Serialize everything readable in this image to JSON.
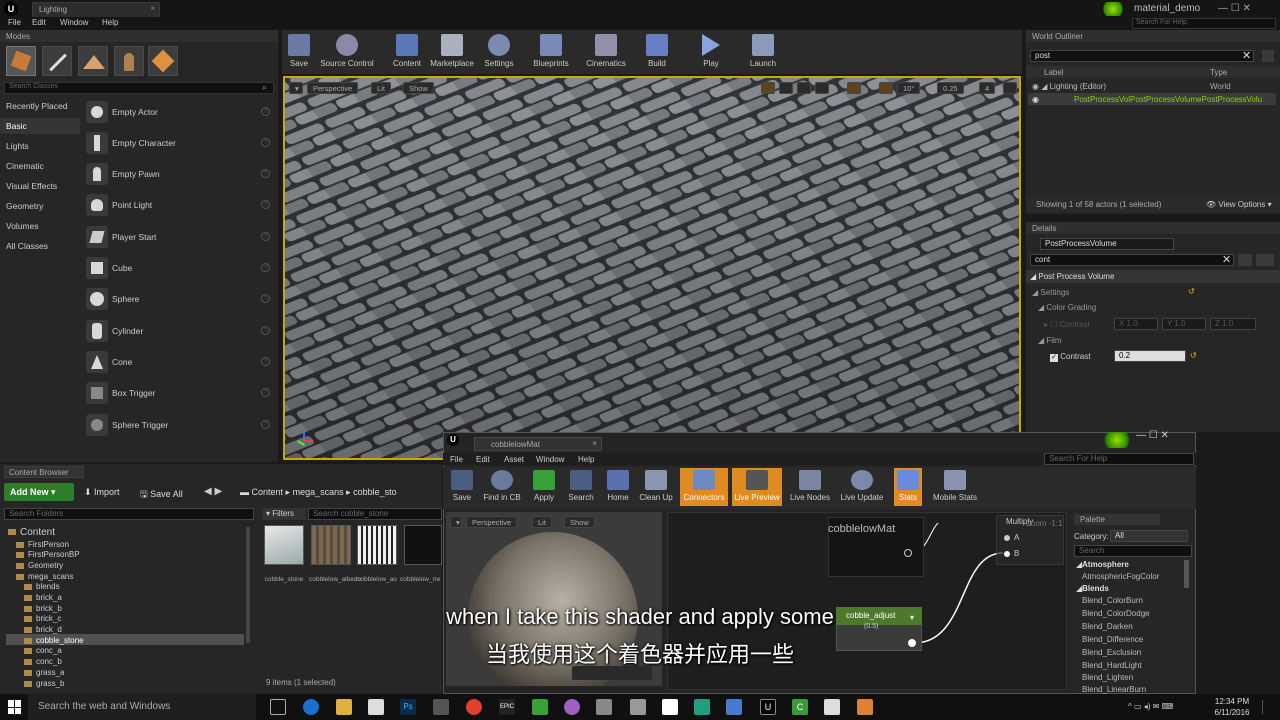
{
  "window": {
    "tab_title": "Lighting",
    "project_name": "material_demo",
    "help_search_placeholder": "Search For Help",
    "menu": [
      "File",
      "Edit",
      "Window",
      "Help"
    ]
  },
  "modes": {
    "header": "Modes",
    "search_placeholder": "Search Classes",
    "categories": [
      "Recently Placed",
      "Basic",
      "Lights",
      "Cinematic",
      "Visual Effects",
      "Geometry",
      "Volumes",
      "All Classes"
    ],
    "selected_category": "Basic",
    "items": [
      "Empty Actor",
      "Empty Character",
      "Empty Pawn",
      "Point Light",
      "Player Start",
      "Cube",
      "Sphere",
      "Cylinder",
      "Cone",
      "Box Trigger",
      "Sphere Trigger"
    ]
  },
  "toolbar": {
    "buttons": [
      "Save",
      "Source Control",
      "Content",
      "Marketplace",
      "Settings",
      "Blueprints",
      "Cinematics",
      "Build",
      "Play",
      "Launch"
    ]
  },
  "viewport": {
    "perspective": "Perspective",
    "lit": "Lit",
    "show": "Show",
    "snap_angle": "10°",
    "snap_scale": "0.25",
    "cam_speed": "4"
  },
  "outliner": {
    "header": "World Outliner",
    "search_value": "post",
    "col_label": "Label",
    "col_type": "Type",
    "row1_label": "Lighting (Editor)",
    "row1_type": "World",
    "row2_label": "PostProcessVolPostProcessVolumePostProcessVolu",
    "status": "Showing 1 of 58 actors (1 selected)",
    "view_options": "View Options"
  },
  "details": {
    "header": "Details",
    "name_value": "PostProcessVolume",
    "search_value": "cont",
    "section": "Post Process Volume",
    "settings": "Settings",
    "color_grading": "Color Grading",
    "contrast_label": "Contrast",
    "x": "X 1.0",
    "y": "Y 1.0",
    "z": "Z 1.0",
    "film": "Film",
    "film_contrast_label": "Contrast",
    "film_contrast_value": "0.2"
  },
  "content_browser": {
    "header": "Content Browser",
    "add_new": "Add New",
    "import": "Import",
    "save_all": "Save All",
    "path": [
      "Content",
      "mega_scans",
      "cobble_sto"
    ],
    "search_folders": "Search Folders",
    "filters": "Filters",
    "search_assets": "Search cobble_stone",
    "tree": [
      "Content",
      "FirstPerson",
      "FirstPersonBP",
      "Geometry",
      "mega_scans",
      "blends",
      "brick_a",
      "brick_b",
      "brick_c",
      "brick_d",
      "cobble_stone",
      "conc_a",
      "conc_b",
      "grass_a",
      "grass_b"
    ],
    "selected_folder": "cobble_stone",
    "assets": [
      "cobble_stone",
      "cobblelow_albedo",
      "cobblelow_ao",
      "cobblelow_metallic"
    ],
    "status": "9 items (1 selected)"
  },
  "material_editor": {
    "tab_title": "cobblelowMat",
    "menu": [
      "File",
      "Edit",
      "Asset",
      "Window",
      "Help"
    ],
    "help_search": "Search For Help",
    "buttons": [
      "Save",
      "Find in CB",
      "Apply",
      "Search",
      "Home",
      "Clean Up",
      "Connectors",
      "Live Preview",
      "Live Nodes",
      "Live Update",
      "Stats",
      "Mobile Stats"
    ],
    "highlighted": [
      "Connectors",
      "Live Preview",
      "Stats"
    ],
    "preview_perspective": "Perspective",
    "preview_lit": "Lit",
    "preview_show": "Show",
    "node_main": "cobblelowMat",
    "node_multiply": "Multiply",
    "pin_a": "A",
    "pin_b": "B",
    "node_param": "cobble_adjust",
    "node_param_value": "(0.5)",
    "zoom": "Zoom -1:1"
  },
  "palette": {
    "header": "Palette",
    "category_label": "Category:",
    "category_value": "All",
    "search_placeholder": "Search",
    "groups": [
      "Atmosphere",
      "Blends"
    ],
    "items": [
      "AtmosphericFogColor",
      "Blend_ColorBurn",
      "Blend_ColorDodge",
      "Blend_Darken",
      "Blend_Difference",
      "Blend_Exclusion",
      "Blend_HardLight",
      "Blend_Lighten",
      "Blend_LinearBurn"
    ]
  },
  "subtitle": {
    "en": "when I take this shader and apply some",
    "zh": "当我使用这个着色器并应用一些"
  },
  "taskbar": {
    "search": "Search the web and Windows",
    "time": "12:34 PM",
    "date": "6/11/2016"
  },
  "colors": {
    "accent": "#c9a800",
    "highlight": "#e08a22",
    "selection_green": "#8bd600"
  }
}
